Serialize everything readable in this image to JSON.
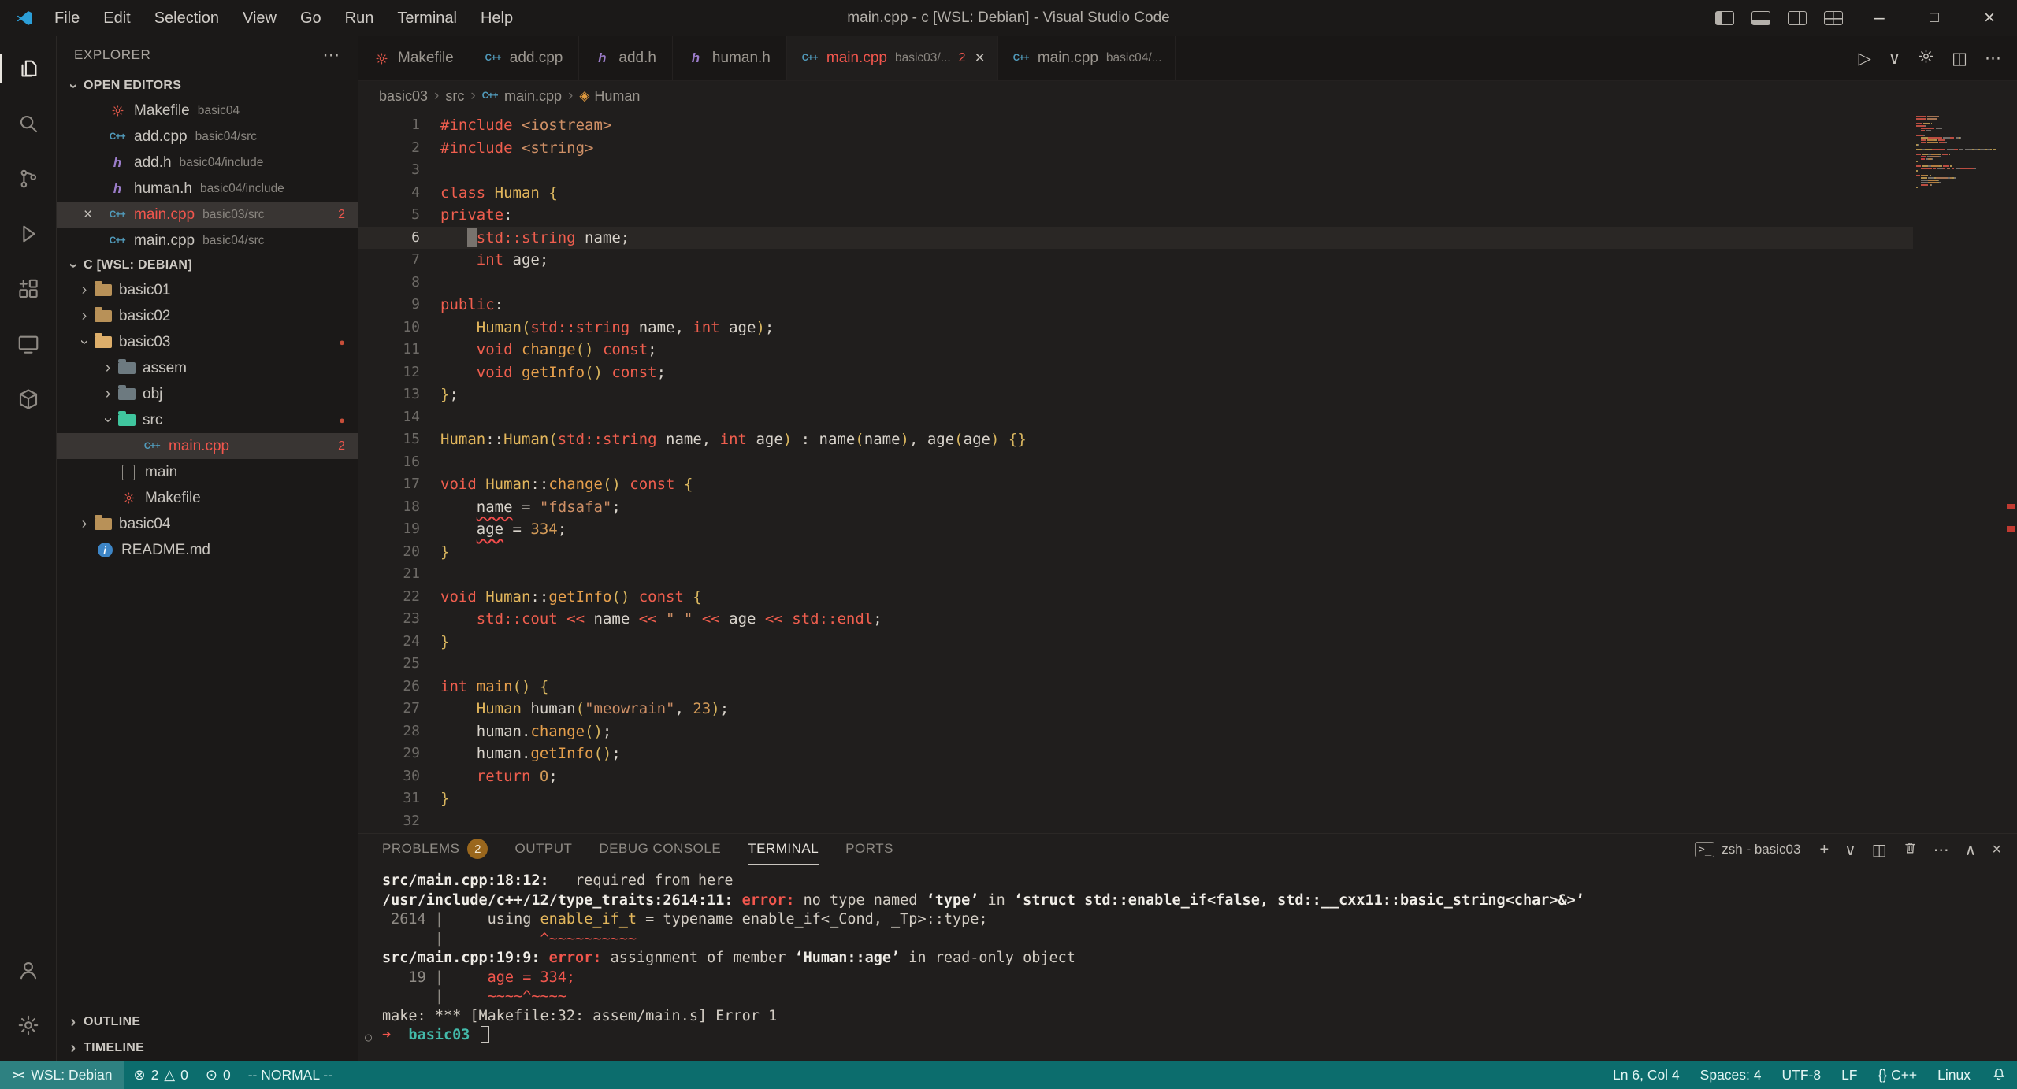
{
  "glyphs": {
    "chevron": "›",
    "close": "×",
    "more": "⋯",
    "plus": "+",
    "run": "▷",
    "chevron_down": "∨",
    "chevron_up": "∧",
    "split": "◫",
    "minimize": "–",
    "maximize": "□",
    "error": "⊗",
    "warning": "△",
    "ports": "⊙",
    "prompt_arrow": "➜",
    "decoration": "○",
    "class_symbol": "◈",
    "remote": "><",
    "dot": "●",
    "shell": ">_"
  },
  "titlebar": {
    "menus": [
      "File",
      "Edit",
      "Selection",
      "View",
      "Go",
      "Run",
      "Terminal",
      "Help"
    ],
    "title": "main.cpp - c [WSL: Debian] - Visual Studio Code"
  },
  "activity_bar": {
    "top": [
      "explorer",
      "search",
      "source-control",
      "run-and-debug",
      "extensions",
      "remote-explorer",
      "containers"
    ],
    "active": "explorer",
    "bottom": [
      "account",
      "manage"
    ]
  },
  "sidebar": {
    "title": "EXPLORER",
    "open_editors": {
      "label": "OPEN EDITORS",
      "items": [
        {
          "icon": "makefile",
          "label": "Makefile",
          "desc": "basic04"
        },
        {
          "icon": "cpp",
          "label": "add.cpp",
          "desc": "basic04/src"
        },
        {
          "icon": "h",
          "label": "add.h",
          "desc": "basic04/include"
        },
        {
          "icon": "h",
          "label": "human.h",
          "desc": "basic04/include"
        },
        {
          "icon": "cpp",
          "label": "main.cpp",
          "desc": "basic03/src",
          "error": true,
          "badge": "2",
          "active": true,
          "closable": true
        },
        {
          "icon": "cpp",
          "label": "main.cpp",
          "desc": "basic04/src"
        }
      ]
    },
    "workspace": {
      "label": "C [WSL: DEBIAN]",
      "items": [
        {
          "type": "folder",
          "label": "basic01",
          "depth": 0,
          "color": "#b89158"
        },
        {
          "type": "folder",
          "label": "basic02",
          "depth": 0,
          "color": "#b89158"
        },
        {
          "type": "folder",
          "label": "basic03",
          "depth": 0,
          "color": "#b89158",
          "expanded": true,
          "dot": true
        },
        {
          "type": "folder",
          "label": "assem",
          "depth": 1,
          "color": "#6d7a80"
        },
        {
          "type": "folder",
          "label": "obj",
          "depth": 1,
          "color": "#6d7a80"
        },
        {
          "type": "folder",
          "label": "src",
          "depth": 1,
          "color": "#35a584",
          "expanded": true,
          "dot": true
        },
        {
          "type": "file",
          "icon": "cpp",
          "label": "main.cpp",
          "depth": 2,
          "error": true,
          "badge": "2",
          "selected": true
        },
        {
          "type": "file",
          "icon": "doc",
          "label": "main",
          "depth": 1
        },
        {
          "type": "file",
          "icon": "makefile",
          "label": "Makefile",
          "depth": 1
        },
        {
          "type": "folder",
          "label": "basic04",
          "depth": 0,
          "color": "#b89158"
        },
        {
          "type": "file",
          "icon": "info",
          "label": "README.md",
          "depth": 0
        }
      ]
    },
    "outline_label": "OUTLINE",
    "timeline_label": "TIMELINE"
  },
  "editor": {
    "tabs": [
      {
        "icon": "makefile",
        "label": "Makefile"
      },
      {
        "icon": "cpp",
        "label": "add.cpp"
      },
      {
        "icon": "h",
        "label": "add.h"
      },
      {
        "icon": "h",
        "label": "human.h"
      },
      {
        "icon": "cpp",
        "label": "main.cpp",
        "desc": "basic03/...",
        "badge": "2",
        "active": true,
        "error": true
      },
      {
        "icon": "cpp",
        "label": "main.cpp",
        "desc": "basic04/..."
      }
    ],
    "actions": [
      {
        "name": "run-or-debug",
        "glyph": "run"
      },
      {
        "name": "run-dropdown",
        "glyph": "chevron_down"
      },
      {
        "name": "configure",
        "icon": "manage"
      },
      {
        "name": "split-editor",
        "glyph": "split"
      },
      {
        "name": "more-actions",
        "glyph": "more"
      }
    ],
    "breadcrumb": [
      {
        "label": "basic03"
      },
      {
        "label": "src"
      },
      {
        "label": "main.cpp",
        "icon": "cpp"
      },
      {
        "label": "Human",
        "icon": "class"
      }
    ],
    "current_line": 6,
    "error_lines": [
      18,
      19
    ],
    "lines": [
      [
        [
          "k",
          "#include"
        ],
        [
          "p",
          " "
        ],
        [
          "s",
          "<iostream>"
        ]
      ],
      [
        [
          "k",
          "#include"
        ],
        [
          "p",
          " "
        ],
        [
          "s",
          "<string>"
        ]
      ],
      [],
      [
        [
          "k",
          "class"
        ],
        [
          "p",
          " "
        ],
        [
          "c",
          "Human"
        ],
        [
          "p",
          " "
        ],
        [
          "b",
          "{"
        ]
      ],
      [
        [
          "k",
          "private"
        ],
        [
          "p",
          ":"
        ]
      ],
      [
        [
          "p",
          "    "
        ],
        [
          "t",
          "std::string"
        ],
        [
          "p",
          " name;"
        ]
      ],
      [
        [
          "p",
          "    "
        ],
        [
          "t",
          "int"
        ],
        [
          "p",
          " age;"
        ]
      ],
      [],
      [
        [
          "k",
          "public"
        ],
        [
          "p",
          ":"
        ]
      ],
      [
        [
          "p",
          "    "
        ],
        [
          "c",
          "Human"
        ],
        [
          "b",
          "("
        ],
        [
          "t",
          "std::string"
        ],
        [
          "p",
          " name, "
        ],
        [
          "t",
          "int"
        ],
        [
          "p",
          " age"
        ],
        [
          "b",
          ")"
        ],
        [
          "p",
          ";"
        ]
      ],
      [
        [
          "p",
          "    "
        ],
        [
          "t",
          "void"
        ],
        [
          "p",
          " "
        ],
        [
          "f",
          "change"
        ],
        [
          "b",
          "()"
        ],
        [
          "p",
          " "
        ],
        [
          "k",
          "const"
        ],
        [
          "p",
          ";"
        ]
      ],
      [
        [
          "p",
          "    "
        ],
        [
          "t",
          "void"
        ],
        [
          "p",
          " "
        ],
        [
          "f",
          "getInfo"
        ],
        [
          "b",
          "()"
        ],
        [
          "p",
          " "
        ],
        [
          "k",
          "const"
        ],
        [
          "p",
          ";"
        ]
      ],
      [
        [
          "b",
          "}"
        ],
        [
          "p",
          ";"
        ]
      ],
      [],
      [
        [
          "c",
          "Human"
        ],
        [
          "p",
          "::"
        ],
        [
          "c",
          "Human"
        ],
        [
          "b",
          "("
        ],
        [
          "t",
          "std::string"
        ],
        [
          "p",
          " name, "
        ],
        [
          "t",
          "int"
        ],
        [
          "p",
          " age"
        ],
        [
          "b",
          ")"
        ],
        [
          "p",
          " : name"
        ],
        [
          "b",
          "("
        ],
        [
          "p",
          "name"
        ],
        [
          "b",
          ")"
        ],
        [
          "p",
          ", age"
        ],
        [
          "b",
          "("
        ],
        [
          "p",
          "age"
        ],
        [
          "b",
          ")"
        ],
        [
          "p",
          " "
        ],
        [
          "b",
          "{}"
        ]
      ],
      [],
      [
        [
          "t",
          "void"
        ],
        [
          "p",
          " "
        ],
        [
          "c",
          "Human"
        ],
        [
          "p",
          "::"
        ],
        [
          "f",
          "change"
        ],
        [
          "b",
          "()"
        ],
        [
          "p",
          " "
        ],
        [
          "k",
          "const"
        ],
        [
          "p",
          " "
        ],
        [
          "b",
          "{"
        ]
      ],
      [
        [
          "p",
          "    "
        ],
        [
          "e",
          "name"
        ],
        [
          "p",
          " = "
        ],
        [
          "s",
          "\"fdsafa\""
        ],
        [
          "p",
          ";"
        ]
      ],
      [
        [
          "p",
          "    "
        ],
        [
          "e",
          "age"
        ],
        [
          "p",
          " = "
        ],
        [
          "n",
          "334"
        ],
        [
          "p",
          ";"
        ]
      ],
      [
        [
          "b",
          "}"
        ]
      ],
      [],
      [
        [
          "t",
          "void"
        ],
        [
          "p",
          " "
        ],
        [
          "c",
          "Human"
        ],
        [
          "p",
          "::"
        ],
        [
          "f",
          "getInfo"
        ],
        [
          "b",
          "()"
        ],
        [
          "p",
          " "
        ],
        [
          "k",
          "const"
        ],
        [
          "p",
          " "
        ],
        [
          "b",
          "{"
        ]
      ],
      [
        [
          "p",
          "    "
        ],
        [
          "t",
          "std::cout"
        ],
        [
          "p",
          " "
        ],
        [
          "o",
          "<<"
        ],
        [
          "p",
          " name "
        ],
        [
          "o",
          "<<"
        ],
        [
          "p",
          " "
        ],
        [
          "s",
          "\" \""
        ],
        [
          "p",
          " "
        ],
        [
          "o",
          "<<"
        ],
        [
          "p",
          " age "
        ],
        [
          "o",
          "<<"
        ],
        [
          "p",
          " "
        ],
        [
          "t",
          "std::endl"
        ],
        [
          "p",
          ";"
        ]
      ],
      [
        [
          "b",
          "}"
        ]
      ],
      [],
      [
        [
          "t",
          "int"
        ],
        [
          "p",
          " "
        ],
        [
          "f",
          "main"
        ],
        [
          "b",
          "()"
        ],
        [
          "p",
          " "
        ],
        [
          "b",
          "{"
        ]
      ],
      [
        [
          "p",
          "    "
        ],
        [
          "c",
          "Human"
        ],
        [
          "p",
          " human"
        ],
        [
          "b",
          "("
        ],
        [
          "s",
          "\"meowrain\""
        ],
        [
          "p",
          ", "
        ],
        [
          "n",
          "23"
        ],
        [
          "b",
          ")"
        ],
        [
          "p",
          ";"
        ]
      ],
      [
        [
          "p",
          "    human."
        ],
        [
          "f",
          "change"
        ],
        [
          "b",
          "()"
        ],
        [
          "p",
          ";"
        ]
      ],
      [
        [
          "p",
          "    human."
        ],
        [
          "f",
          "getInfo"
        ],
        [
          "b",
          "()"
        ],
        [
          "p",
          ";"
        ]
      ],
      [
        [
          "p",
          "    "
        ],
        [
          "k",
          "return"
        ],
        [
          "p",
          " "
        ],
        [
          "n",
          "0"
        ],
        [
          "p",
          ";"
        ]
      ],
      [
        [
          "b",
          "}"
        ]
      ],
      []
    ]
  },
  "panel": {
    "tabs": [
      {
        "label": "PROBLEMS",
        "badge": "2"
      },
      {
        "label": "OUTPUT"
      },
      {
        "label": "DEBUG CONSOLE"
      },
      {
        "label": "TERMINAL",
        "active": true
      },
      {
        "label": "PORTS"
      }
    ],
    "terminal_label": "zsh - basic03",
    "actions": [
      {
        "name": "new-terminal",
        "glyph": "plus"
      },
      {
        "name": "launch-profile-dropdown",
        "glyph": "chevron_down"
      },
      {
        "name": "split-terminal",
        "glyph": "split"
      },
      {
        "name": "kill-terminal",
        "icon": "trash"
      },
      {
        "name": "more-actions",
        "glyph": "more"
      },
      {
        "name": "maximize-panel",
        "glyph": "chevron_up"
      },
      {
        "name": "close-panel",
        "glyph": "close"
      }
    ],
    "terminal_lines": [
      {
        "t": [
          [
            "B",
            "src/main.cpp:18:12:"
          ],
          [
            "w",
            "   required from here"
          ]
        ]
      },
      {
        "t": [
          [
            "B",
            "/usr/include/c++/12/type_traits:2614:11:"
          ],
          [
            "R",
            " error: "
          ],
          [
            "w",
            "no type named "
          ],
          [
            "B",
            "‘type’"
          ],
          [
            "w",
            " in "
          ],
          [
            "B",
            "‘struct std::enable_if<false, std::__cxx11::basic_string<char>&>’"
          ]
        ]
      },
      {
        "t": [
          [
            "g",
            " 2614 |"
          ],
          [
            "w",
            "     using "
          ],
          [
            "y",
            "enable_if_t"
          ],
          [
            "w",
            " = typename enable_if<_Cond, _Tp>::type;"
          ]
        ]
      },
      {
        "t": [
          [
            "g",
            "      |"
          ],
          [
            "r",
            "           ^~~~~~~~~~~"
          ]
        ]
      },
      {
        "t": [
          [
            "B",
            "src/main.cpp:19:9:"
          ],
          [
            "R",
            " error: "
          ],
          [
            "w",
            "assignment of member "
          ],
          [
            "B",
            "‘Human::age’"
          ],
          [
            "w",
            " in read-only object"
          ]
        ]
      },
      {
        "t": [
          [
            "g",
            "   19 |"
          ],
          [
            "r",
            "     age = 334;"
          ]
        ]
      },
      {
        "t": [
          [
            "g",
            "      |"
          ],
          [
            "r",
            "     ~~~~^~~~~"
          ]
        ]
      },
      {
        "t": [
          [
            "w",
            "make: *** [Makefile:32: assem/main.s] Error 1"
          ]
        ]
      },
      {
        "decoration": true,
        "t": [
          [
            "ar",
            "➜"
          ],
          [
            "w",
            "  "
          ],
          [
            "c",
            "basic03"
          ],
          [
            "w",
            " "
          ],
          [
            "cur",
            ""
          ]
        ]
      }
    ]
  },
  "status_bar": {
    "remote": "WSL: Debian",
    "errors": "2",
    "warnings": "0",
    "ports": "0",
    "mode": "-- NORMAL --",
    "right": [
      {
        "name": "cursor-position",
        "label": "Ln 6, Col 4"
      },
      {
        "name": "indentation",
        "label": "Spaces: 4"
      },
      {
        "name": "encoding",
        "label": "UTF-8"
      },
      {
        "name": "eol",
        "label": "LF"
      },
      {
        "name": "language-mode",
        "label": "{} C++"
      },
      {
        "name": "remote-os",
        "label": "Linux"
      }
    ]
  }
}
